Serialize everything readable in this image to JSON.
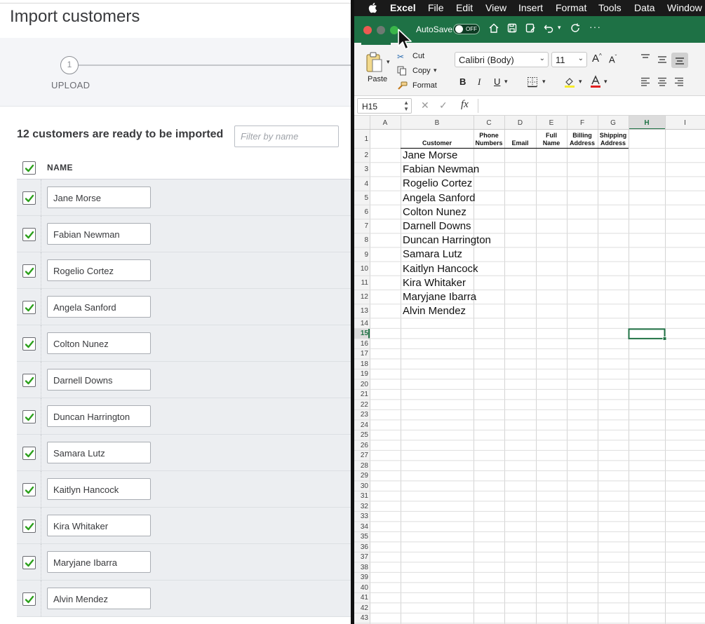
{
  "import_page": {
    "title": "Import customers",
    "step_number": "1",
    "step_label": "UPLOAD",
    "ready_text": "12 customers are ready to be imported",
    "filter_placeholder": "Filter by name",
    "column_header": "NAME",
    "customers": [
      "Jane Morse",
      "Fabian Newman",
      "Rogelio Cortez",
      "Angela Sanford",
      "Colton Nunez",
      "Darnell Downs",
      "Duncan Harrington",
      "Samara Lutz",
      "Kaitlyn Hancock",
      "Kira Whitaker",
      "Maryjane Ibarra",
      "Alvin Mendez"
    ]
  },
  "menubar": {
    "app": "Excel",
    "items": [
      "File",
      "Edit",
      "View",
      "Insert",
      "Format",
      "Tools",
      "Data",
      "Window"
    ]
  },
  "titlebar": {
    "autosave_label": "AutoSave",
    "toggle_state": "OFF"
  },
  "ribbon": {
    "paste_label": "Paste",
    "cut_label": "Cut",
    "copy_label": "Copy",
    "format_label": "Format",
    "font_name": "Calibri (Body)",
    "font_size": "11",
    "grow_font": "A",
    "shrink_font": "A",
    "bold": "B",
    "italic": "I",
    "underline": "U"
  },
  "formula_bar": {
    "name_box": "H15",
    "fx": "fx",
    "value": ""
  },
  "sheet": {
    "columns": [
      "A",
      "B",
      "C",
      "D",
      "E",
      "F",
      "G",
      "H",
      "I"
    ],
    "selected_column": "H",
    "selected_row": "15",
    "header_row": {
      "B": "Customer",
      "C": "Phone\nNumbers",
      "D": "Email",
      "E": "Full\nName",
      "F": "Billing\nAddress",
      "G": "Shipping\nAddress"
    },
    "customers": [
      "Jane Morse",
      "Fabian Newman",
      "Rogelio Cortez",
      "Angela Sanford",
      "Colton Nunez",
      "Darnell Downs",
      "Duncan Harrington",
      "Samara Lutz",
      "Kaitlyn Hancock",
      "Kira Whitaker",
      "Maryjane Ibarra",
      "Alvin Mendez"
    ],
    "row_count": 43
  },
  "colors": {
    "excel_green": "#1e7145",
    "checkbox_green": "#2ca01c",
    "selection_green": "#217346"
  }
}
